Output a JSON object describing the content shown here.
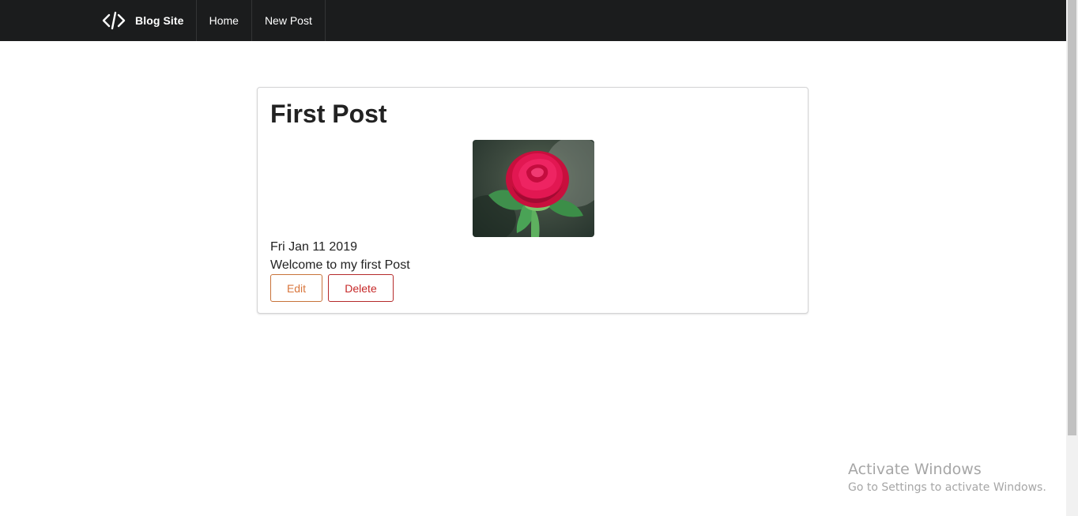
{
  "navbar": {
    "brand_name": "Blog Site",
    "brand_icon": "code-icon",
    "items": [
      {
        "label": "Home"
      },
      {
        "label": "New Post"
      }
    ]
  },
  "post": {
    "title": "First Post",
    "image_subject": "rose-image",
    "date": "Fri Jan 11 2019",
    "body": "Welcome to my first Post",
    "edit_label": "Edit",
    "delete_label": "Delete"
  },
  "watermark": {
    "title": "Activate Windows",
    "subtitle": "Go to Settings to activate Windows."
  },
  "colors": {
    "navbar_bg": "#1b1c1d",
    "edit_accent": "#d9763c",
    "delete_accent": "#c62828"
  }
}
